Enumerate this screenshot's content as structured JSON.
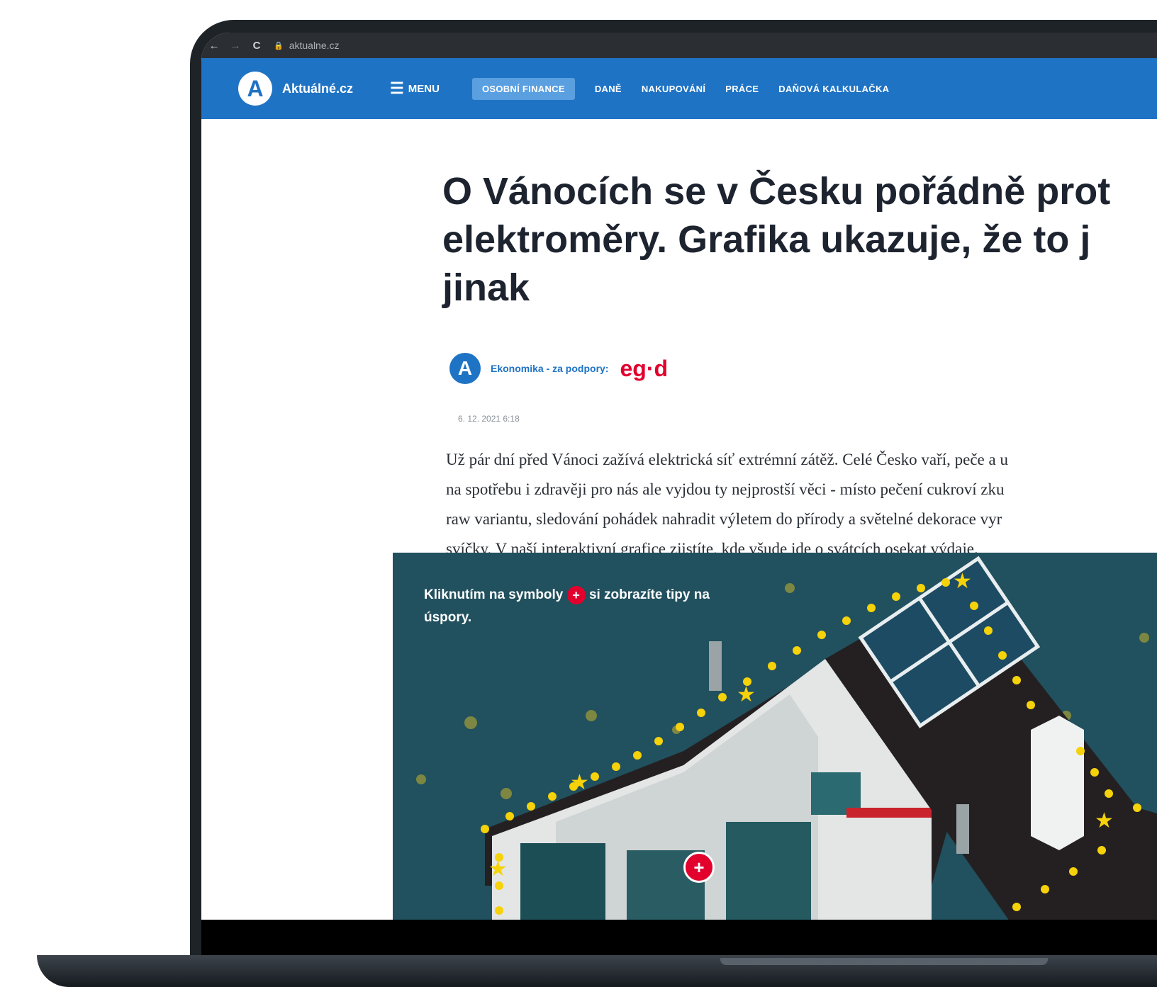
{
  "browser": {
    "back": "←",
    "forward": "→",
    "reload": "C",
    "lock": "🔒",
    "url": "aktualne.cz"
  },
  "site": {
    "logo_letter": "A",
    "logo_text": "Aktuálné.cz",
    "menu_label": "MENU",
    "nav": [
      {
        "label": "OSOBNÍ FINANCE",
        "active": true
      },
      {
        "label": "DANĚ"
      },
      {
        "label": "NAKUPOVÁNÍ"
      },
      {
        "label": "PRÁCE"
      },
      {
        "label": "DAŇOVÁ KALKULAČKA"
      }
    ],
    "brand_color": "#1f73c4"
  },
  "article": {
    "headline_lines": [
      "O Vánocích se v Česku pořádně prot",
      "elektroměry. Grafika ukazuje, že to j",
      "jinak"
    ],
    "section_logo": "A",
    "section": "Ekonomika - za podpory:",
    "sponsor": "eg·d",
    "date": "6. 12. 2021 6:18",
    "lead_lines": [
      "Už pár dní před Vánoci zažívá elektrická síť extrémní zátěž. Celé Česko vaří, peče a u",
      "na spotřebu i zdravěji pro nás ale vyjdou ty nejprostší věci - místo pečení cukroví zku",
      "raw variantu, sledování pohádek nahradit výletem do přírody a světelné dekorace vyr",
      "svíčky. V naší interaktivní grafice zjistíte, kde všude jde o svátcích osekat výdaje."
    ]
  },
  "graphic": {
    "hint_before": "Kliknutím na symboly",
    "hint_badge": "+",
    "hint_after": "si zobrazíte tipy na úspory.",
    "hotspot": "+",
    "bg_color": "#21505e",
    "light_color": "#f5d20a"
  }
}
